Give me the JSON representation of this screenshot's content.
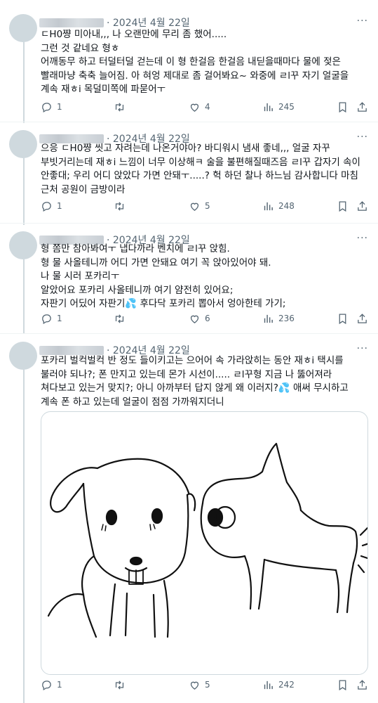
{
  "tweets": [
    {
      "date": "· 2024년 4월 22일",
      "lines": [
        "ㄷH0쨩 미아내,,, 나 오랜만에 무리 좀 했어.....",
        "그런 것 같네요 형ㅎ",
        "어깨동무 하고 터덜터덜 걷는데 이 형 한걸음 한걸음 내딛을때마다 물에 젖은 빨래마냥 축축 늘어짐. 아 혀엉 제대로 좀 걸어봐요~ 와중에 ㄹl꾸 자기 얼굴을 계속 재ㅎi 목덜미쪽에 파묻어ㅜ"
      ],
      "replies": "1",
      "likes": "4",
      "views": "245"
    },
    {
      "date": "· 2024년 4월 22일",
      "lines": [
        "으응 ㄷH0쨩 씻고 자려는데 나온거야아? 바디워시 냄새 좋네,,, 얼굴 자꾸 부빗거리는데 재ㅎi 느낌이 너무 이상해ㅋ 술을 불편해질때즈음 ㄹl꾸 갑자기 속이 안좋대; 우리 어디 앉았다 가면 안돼ㅜ.....? 헉 하던 찰나 하느님 감사합니다 마침 근처 공원이 금방이라"
      ],
      "replies": "1",
      "likes": "5",
      "views": "248"
    },
    {
      "date": "· 2024년 4월 22일",
      "lines": [
        "형 쫌만 참아봐여ㅜ 냅다까라 벤치에 ㄹl꾸 앉힘.",
        "형 물 사올테니까 어디 가면 안돼요 여기 꼭 앉아있어야 돼.",
        "나 물 시러 포카리ㅜ",
        "알았어요 포카리 사올테니까 여기 얌전히 있어요;",
        "자판기 어딨어 자판기💦 후다닥 포카리 뽑아서 엉아한테 가기;"
      ],
      "replies": "1",
      "likes": "6",
      "views": "236"
    },
    {
      "date": "· 2024년 4월 22일",
      "lines": [
        "포카리 벌컥벌컥 반 정도 들이키고는 으어어 속 가라앉히는 동안 재ㅎi 택시를 불러야 되나?; 폰 만지고 있는데 몬가 시선이..... ㄹl꾸형 지금 나 뚫어져라 쳐다보고 있는거 맞지?; 아니 아까부터 답지 않게 왜 이러지?💦 애써 무시하고 계속 폰 하고 있는데 얼굴이 점점 가까워지더니"
      ],
      "replies": "1",
      "likes": "5",
      "views": "242"
    }
  ],
  "more_label": "···",
  "icons": {
    "reply": "reply-icon",
    "retweet": "retweet-icon",
    "like": "heart-icon",
    "views": "views-icon",
    "bookmark": "bookmark-icon",
    "share": "share-icon"
  },
  "colors": {
    "text": "#0f1419",
    "muted": "#536471",
    "border": "#cfd9de"
  }
}
